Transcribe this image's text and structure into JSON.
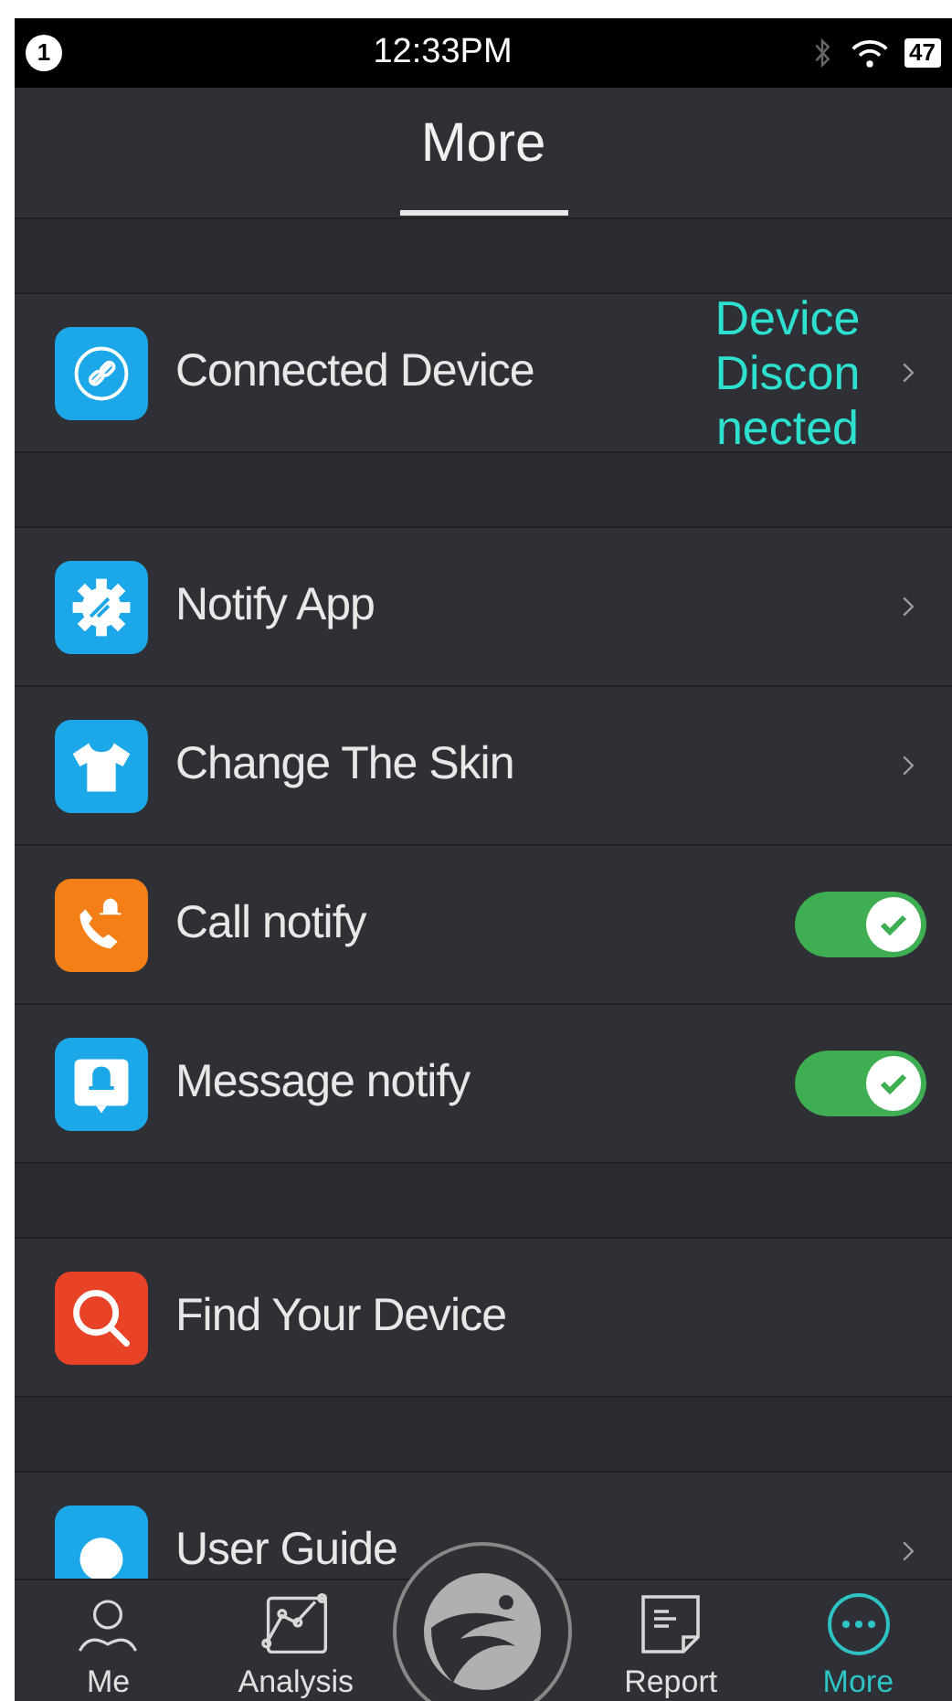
{
  "status_bar": {
    "notification_count": "1",
    "time": "12:33PM",
    "battery": "47"
  },
  "header": {
    "title": "More"
  },
  "sections": [
    {
      "rows": [
        {
          "kind": "link",
          "label": "Connected Device",
          "value": "Device Discon nected"
        }
      ]
    },
    {
      "rows": [
        {
          "kind": "link",
          "label": "Notify App"
        },
        {
          "kind": "link",
          "label": "Change The Skin"
        },
        {
          "kind": "toggle",
          "label": "Call notify",
          "on": true
        },
        {
          "kind": "toggle",
          "label": "Message notify",
          "on": true
        }
      ]
    },
    {
      "rows": [
        {
          "kind": "plain",
          "label": "Find Your Device"
        }
      ]
    },
    {
      "rows": [
        {
          "kind": "link",
          "label": "User Guide"
        }
      ]
    }
  ],
  "tab_bar": [
    {
      "kind": "tab",
      "label": "Me",
      "selected": false
    },
    {
      "kind": "tab",
      "label": "Analysis",
      "selected": false
    },
    {
      "kind": "center",
      "selected": false
    },
    {
      "kind": "tab",
      "label": "Report",
      "selected": false
    },
    {
      "kind": "tab",
      "label": "More",
      "selected": true
    }
  ]
}
